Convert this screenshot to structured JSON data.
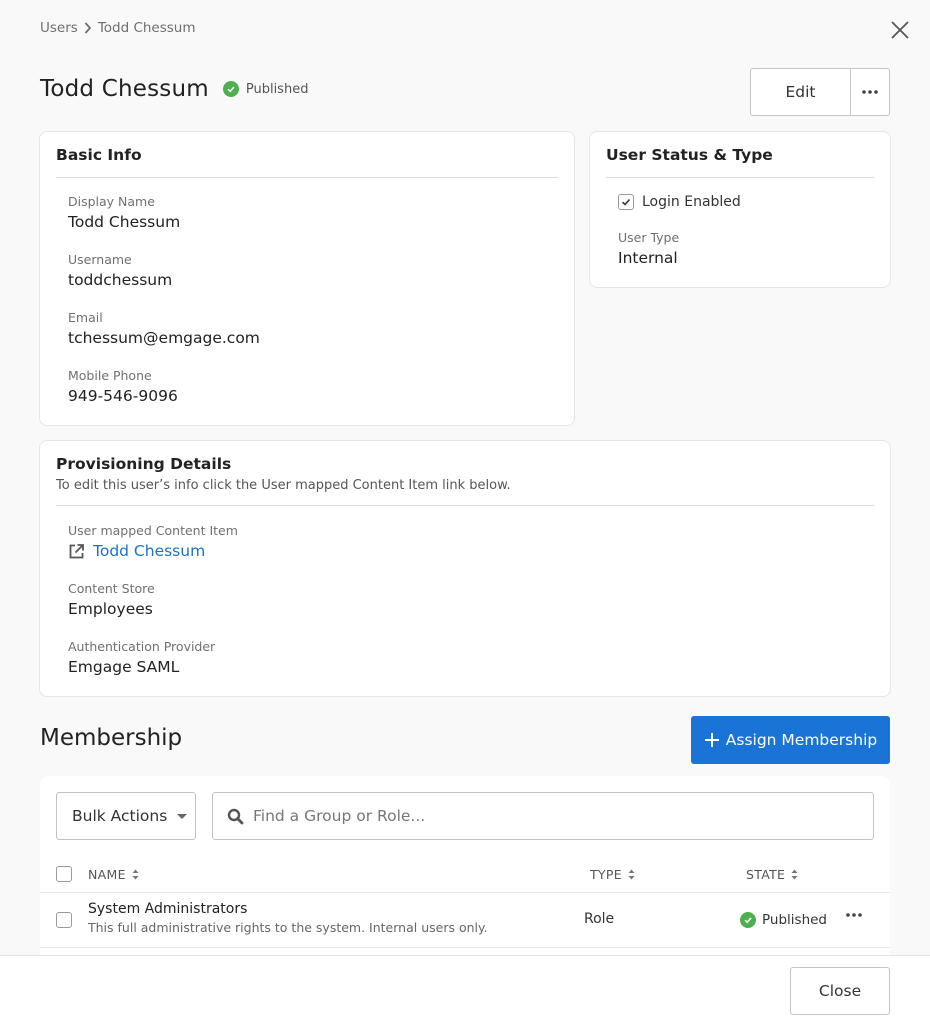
{
  "breadcrumb": {
    "items": [
      "Users",
      "Todd Chessum"
    ]
  },
  "header": {
    "title": "Todd Chessum",
    "status": "Published",
    "edit_label": "Edit"
  },
  "basic_info": {
    "title": "Basic Info",
    "fields": [
      {
        "label": "Display Name",
        "value": "Todd Chessum"
      },
      {
        "label": "Username",
        "value": "toddchessum"
      },
      {
        "label": "Email",
        "value": "tchessum@emgage.com"
      },
      {
        "label": "Mobile Phone",
        "value": "949-546-9096"
      }
    ]
  },
  "status_type": {
    "title": "User Status & Type",
    "login_enabled_label": "Login Enabled",
    "login_enabled": true,
    "user_type_label": "User Type",
    "user_type": "Internal"
  },
  "provisioning": {
    "title": "Provisioning Details",
    "subtitle": "To edit this user’s info click the User mapped Content Item link below.",
    "mapped_label": "User mapped Content Item",
    "mapped_link": "Todd Chessum",
    "content_store_label": "Content Store",
    "content_store": "Employees",
    "auth_provider_label": "Authentication Provider",
    "auth_provider": "Emgage SAML"
  },
  "membership": {
    "title": "Membership",
    "assign_label": "Assign Membership",
    "bulk_actions_label": "Bulk Actions",
    "search_placeholder": "Find a Group or Role...",
    "search_value": "",
    "columns": {
      "name": "NAME",
      "type": "TYPE",
      "state": "STATE"
    },
    "rows": [
      {
        "name": "System Administrators",
        "description": "This full administrative rights to the system. Internal users only.",
        "type": "Role",
        "state": "Published"
      }
    ]
  },
  "footer": {
    "close_label": "Close"
  },
  "colors": {
    "primary": "#1a73d6",
    "link": "#1a73c8",
    "success": "#4caf50"
  }
}
